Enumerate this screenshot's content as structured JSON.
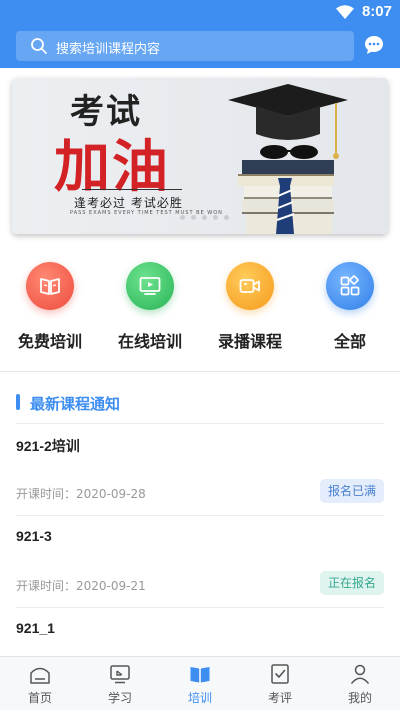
{
  "status": {
    "time": "8:07"
  },
  "search": {
    "placeholder": "搜索培训课程内容"
  },
  "banner": {
    "title_top": "考试",
    "title_main": "加油",
    "slogan": "逢考必过 考试必胜",
    "small_text": "PASS EXAMS EVERY TIME TEST MUST BE WON"
  },
  "shortcuts": [
    {
      "label": "免费培训",
      "icon": "book-open-icon",
      "color": "#f25d4f"
    },
    {
      "label": "在线培训",
      "icon": "monitor-play-icon",
      "color": "#3ec36b"
    },
    {
      "label": "录播课程",
      "icon": "video-camera-icon",
      "color": "#f7a52b"
    },
    {
      "label": "全部",
      "icon": "grid-apps-icon",
      "color": "#3d8ef0"
    }
  ],
  "section": {
    "title": "最新课程通知"
  },
  "courses": [
    {
      "name": "921-2培训",
      "date": "开课时间：2020-09-28",
      "status": "报名已满"
    },
    {
      "name": "921-3",
      "date": "开课时间：2020-09-21",
      "status": "正在报名"
    },
    {
      "name": "921_1"
    }
  ],
  "tabs": [
    {
      "label": "首页",
      "icon": "home-icon"
    },
    {
      "label": "学习",
      "icon": "study-screen-icon"
    },
    {
      "label": "培训",
      "icon": "open-book-icon",
      "active": true
    },
    {
      "label": "考评",
      "icon": "checklist-icon"
    },
    {
      "label": "我的",
      "icon": "person-icon"
    }
  ],
  "colors": {
    "primary": "#3d8ef0",
    "banner_red": "#d32226",
    "badge_full": "#4a7fcf",
    "badge_open": "#35a88f"
  }
}
